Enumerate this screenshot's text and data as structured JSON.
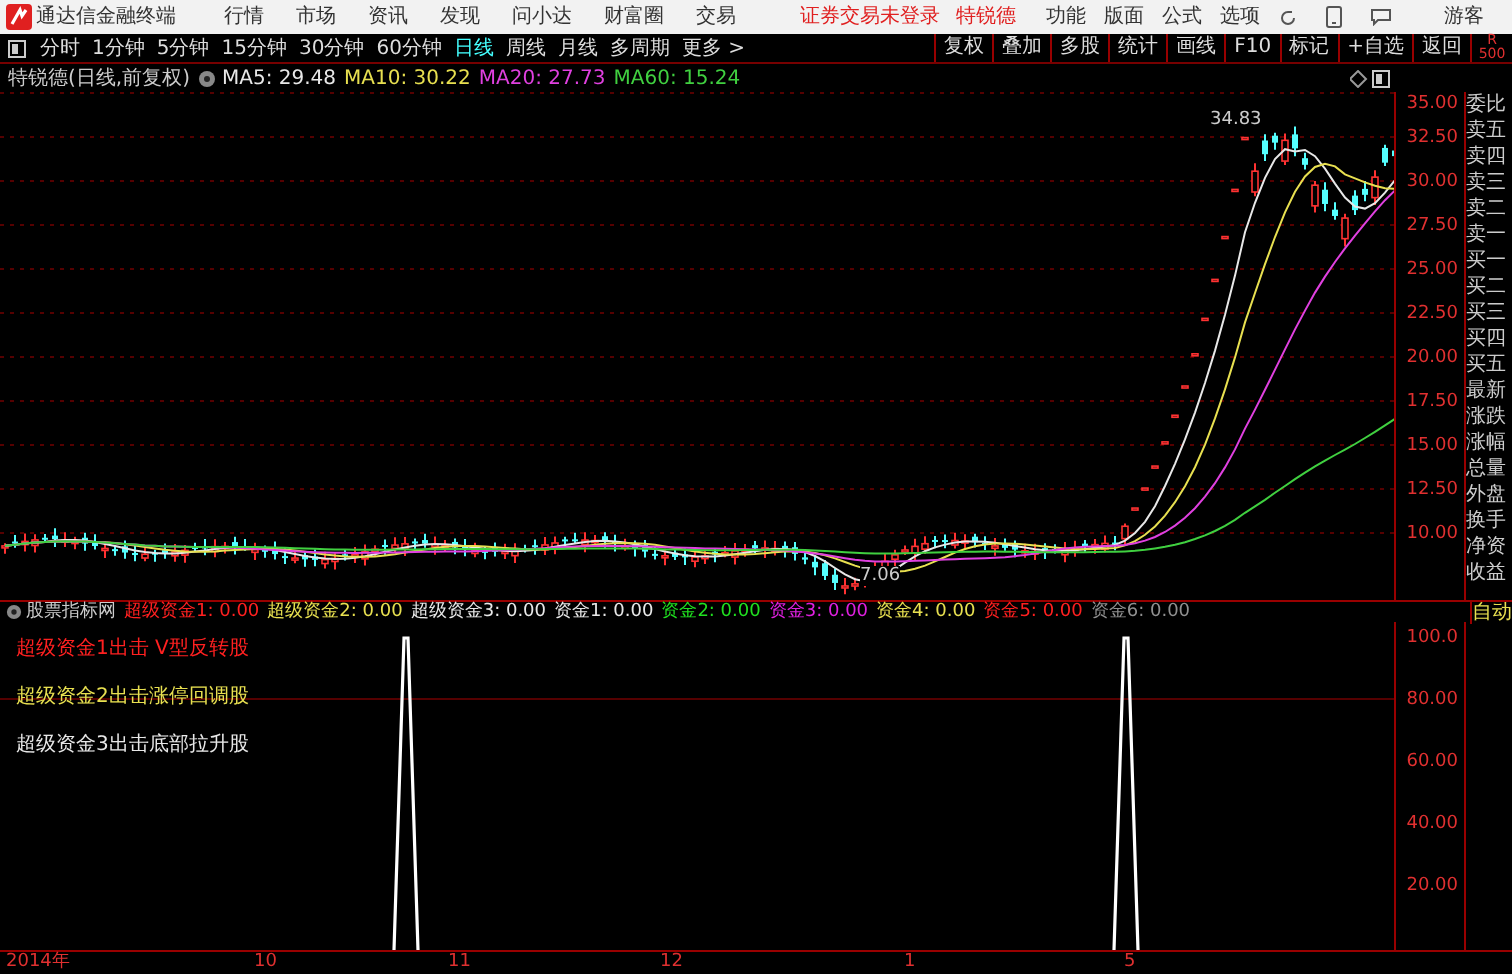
{
  "title_bar": {
    "app_name": "通达信金融终端",
    "menu": [
      "行情",
      "市场",
      "资讯",
      "发现",
      "问小达",
      "财富圈",
      "交易"
    ],
    "status": [
      {
        "text": "证券交易未登录"
      },
      {
        "text": "特锐德"
      }
    ],
    "right_menu": [
      "功能",
      "版面",
      "公式",
      "选项"
    ],
    "user": "游客"
  },
  "toolbar": {
    "periods": [
      {
        "label": "分时",
        "selected": false
      },
      {
        "label": "1分钟",
        "selected": false
      },
      {
        "label": "5分钟",
        "selected": false
      },
      {
        "label": "15分钟",
        "selected": false
      },
      {
        "label": "30分钟",
        "selected": false
      },
      {
        "label": "60分钟",
        "selected": false
      },
      {
        "label": "日线",
        "selected": true
      },
      {
        "label": "周线",
        "selected": false
      },
      {
        "label": "月线",
        "selected": false
      },
      {
        "label": "多周期",
        "selected": false
      },
      {
        "label": "更多 >",
        "selected": false
      }
    ],
    "buttons": [
      "复权",
      "叠加",
      "多股",
      "统计",
      "画线",
      "F10",
      "标记",
      "+自选",
      "返回"
    ],
    "corner": [
      "R",
      "500"
    ]
  },
  "info": {
    "title": "特锐德(日线,前复权)",
    "ma": [
      {
        "label": "MA5: 29.48",
        "color": "#e8e8e8"
      },
      {
        "label": "MA10: 30.22",
        "color": "#e8e050"
      },
      {
        "label": "MA20: 27.73",
        "color": "#e040e0"
      },
      {
        "label": "MA60: 15.24",
        "color": "#40d040"
      }
    ]
  },
  "price_axis": [
    "35.00",
    "32.50",
    "30.00",
    "27.50",
    "25.00",
    "22.50",
    "20.00",
    "17.50",
    "15.00",
    "12.50",
    "10.00"
  ],
  "price_annotations": {
    "high": "34.83",
    "low": "7.06"
  },
  "side_panel": {
    "labels": [
      "委比",
      "卖五",
      "卖四",
      "卖三",
      "卖二",
      "卖一",
      "买一",
      "买二",
      "买三",
      "买四",
      "买五",
      "最新",
      "涨跌",
      "涨幅",
      "总量",
      "外盘",
      "换手",
      "净资",
      "收益"
    ],
    "mode": "自动"
  },
  "indicator": {
    "name": "股票指标网",
    "values": [
      {
        "label": "超级资金1: 0.00",
        "color": "#ff2020"
      },
      {
        "label": "超级资金2: 0.00",
        "color": "#e8e050"
      },
      {
        "label": "超级资金3: 0.00",
        "color": "#e8e8e8"
      },
      {
        "label": "资金1: 0.00",
        "color": "#e8e8e8"
      },
      {
        "label": "资金2: 0.00",
        "color": "#20e020"
      },
      {
        "label": "资金3: 0.00",
        "color": "#e020e0"
      },
      {
        "label": "资金4: 0.00",
        "color": "#e8e050"
      },
      {
        "label": "资金5: 0.00",
        "color": "#ff2020"
      },
      {
        "label": "资金6: 0.00",
        "color": "#909090"
      }
    ],
    "signals": [
      {
        "text": "超级资金1出击 V型反转股",
        "color": "#ff2020"
      },
      {
        "text": "超级资金2出击涨停回调股",
        "color": "#e8e050"
      },
      {
        "text": "超级资金3出击底部拉升股",
        "color": "#e8e8e8"
      }
    ],
    "axis": [
      "100.0",
      "80.00",
      "60.00",
      "40.00",
      "20.00"
    ]
  },
  "x_axis": [
    "2014年",
    "10",
    "11",
    "12",
    "1",
    "5"
  ]
}
